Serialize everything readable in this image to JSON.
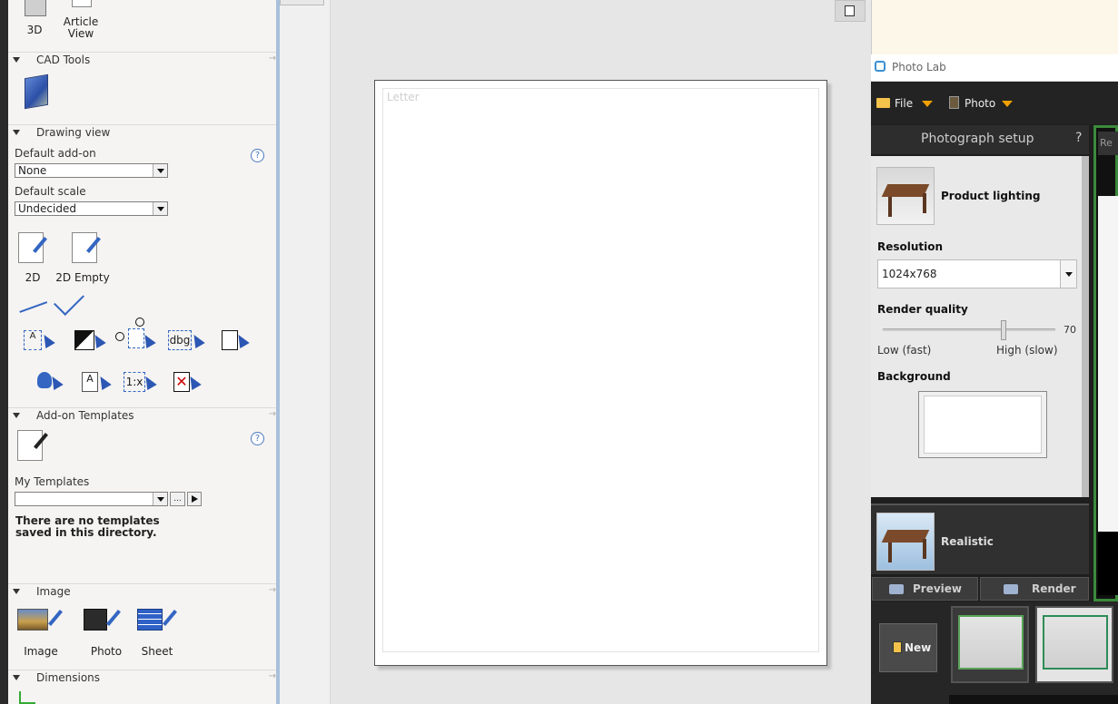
{
  "left_panel": {
    "top_tools": [
      {
        "label": "3D"
      },
      {
        "label": "Article View"
      }
    ],
    "cad_tools": {
      "title": "CAD Tools"
    },
    "drawing_view": {
      "title": "Drawing view",
      "default_addon_label": "Default add-on",
      "default_addon_value": "None",
      "default_scale_label": "Default scale",
      "default_scale_value": "Undecided",
      "views": [
        {
          "label": "2D"
        },
        {
          "label": "2D Empty"
        }
      ],
      "tool_row1_text": [
        "A",
        "dbg"
      ],
      "tool_row2_text": [
        "A",
        "1:x"
      ]
    },
    "addon_templates": {
      "title": "Add-on Templates",
      "my_templates_label": "My Templates",
      "my_templates_value": "",
      "browse_label": "...",
      "empty_message": "There are no templates saved in this directory."
    },
    "image": {
      "title": "Image",
      "items": [
        {
          "label": "Image"
        },
        {
          "label": "Photo"
        },
        {
          "label": "Sheet"
        }
      ]
    },
    "dimensions": {
      "title": "Dimensions"
    },
    "help_glyph": "?"
  },
  "canvas": {
    "paper_label": "Letter"
  },
  "photo_lab": {
    "title": "Photo Lab",
    "menu": [
      {
        "label": "File"
      },
      {
        "label": "Photo"
      }
    ],
    "setup_title": "Photograph setup",
    "help_glyph": "?",
    "product_lighting": "Product lighting",
    "resolution_label": "Resolution",
    "resolution_value": "1024x768",
    "render_quality_label": "Render quality",
    "render_quality_value": "70",
    "render_quality_min": 0,
    "render_quality_max": 100,
    "quality_low": "Low (fast)",
    "quality_high": "High (slow)",
    "background_label": "Background",
    "realistic_label": "Realistic",
    "preview_label": "Preview",
    "render_label": "Render",
    "new_label": "New",
    "right_tab_label": "Re"
  }
}
